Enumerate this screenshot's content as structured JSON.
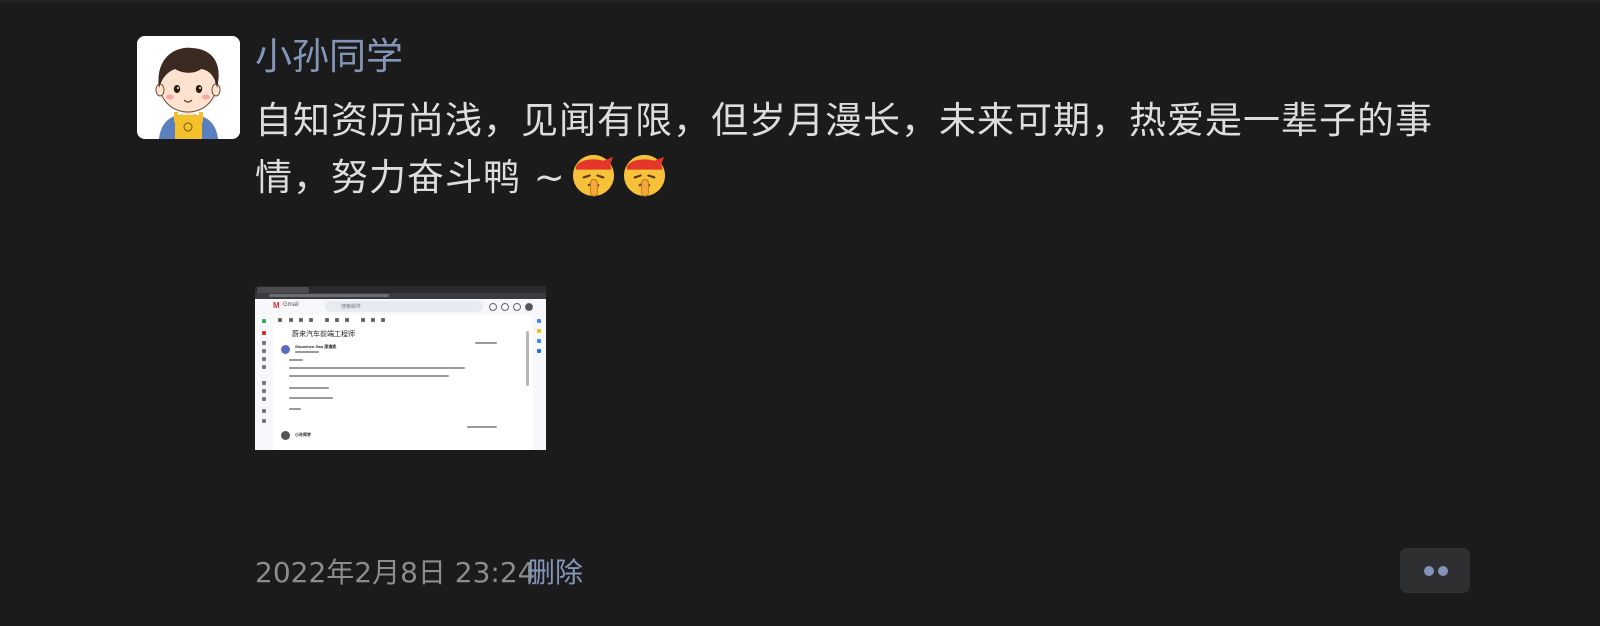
{
  "post": {
    "author": "小孙同学",
    "text_line1": "自知资历尚浅，见闻有限，但岁月漫长，未来可期，热爱是一辈子的事",
    "text_line2": "情，努力奋斗鸭 ~",
    "emojis": [
      "shushing-face-emoji",
      "shushing-face-emoji"
    ]
  },
  "attachment": {
    "gmail_label": "Gmail",
    "subject": "蔚来汽车前端工程师",
    "search_placeholder": "搜索邮件",
    "sender": "Shuochen Gao 邵逸凯",
    "reply_sender": "小孙同学"
  },
  "footer": {
    "date": "2022年2月8日 23:24",
    "delete_label": "删除"
  },
  "colors": {
    "background": "#1b1b1c",
    "accent": "#8396b8",
    "text": "#dddddd",
    "muted": "#8c8c8c"
  }
}
